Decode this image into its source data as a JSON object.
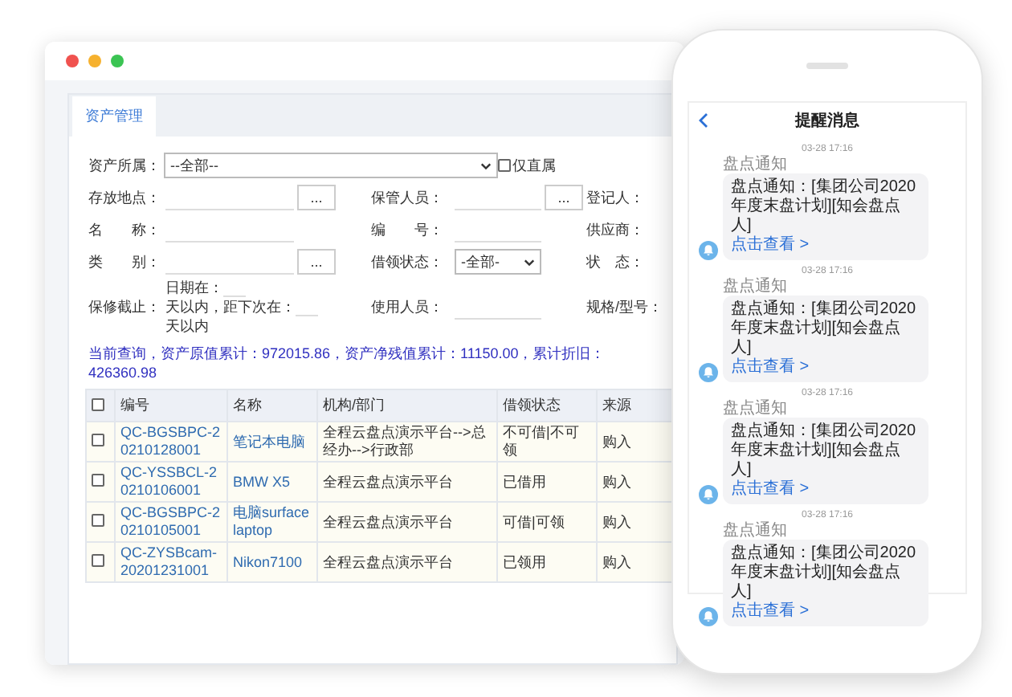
{
  "browser": {
    "tab": {
      "label": "资产管理",
      "selected": true
    },
    "form": {
      "rows": [
        {
          "kind": "owner",
          "label": "资产所属：",
          "select": "--全部--",
          "checkbox": {
            "label": "仅直属",
            "checked": false
          }
        },
        {
          "kind": "fields",
          "cells": [
            {
              "label": "存放地点：",
              "kind": "input",
              "button": "..."
            },
            {
              "label": "保管人员：",
              "kind": "input",
              "button": "..."
            },
            {
              "label": "登记人："
            }
          ]
        },
        {
          "kind": "fields",
          "cells": [
            {
              "label": "名　　称：",
              "kind": "input"
            },
            {
              "label": "编　　号：",
              "kind": "input"
            },
            {
              "label": "供应商："
            }
          ]
        },
        {
          "kind": "fields",
          "cells": [
            {
              "label": "类　　别：",
              "kind": "input",
              "button": "..."
            },
            {
              "label": "借领状态：",
              "kind": "select",
              "value": "-全部-"
            },
            {
              "label": "状　态："
            }
          ]
        },
        {
          "kind": "warranty",
          "label": "保修截止：",
          "parts": [
            "日期在：",
            "天以内，距下次在：",
            "天以内"
          ],
          "cells": [
            {
              "label": "使用人员：",
              "kind": "input"
            },
            {
              "label": "规格/型号："
            }
          ]
        }
      ]
    },
    "summary": "当前查询，资产原值累计：972015.86，资产净残值累计：11150.00，累计折旧：426360.98",
    "table": {
      "header_checked": false,
      "columns": [
        "编号",
        "名称",
        "机构/部门",
        "借领状态",
        "来源"
      ],
      "rows": [
        {
          "checked": false,
          "cells": [
            "QC-BGSBPC-20210128001",
            "笔记本电脑",
            "全程云盘点演示平台-->总经办-->行政部",
            "不可借|不可领",
            "购入"
          ]
        },
        {
          "checked": false,
          "cells": [
            "QC-YSSBCL-20210106001",
            "BMW X5",
            "全程云盘点演示平台",
            "已借用",
            "购入"
          ]
        },
        {
          "checked": false,
          "cells": [
            "QC-BGSBPC-20210105001",
            "电脑surface laptop",
            "全程云盘点演示平台",
            "可借|可领",
            "购入"
          ]
        },
        {
          "checked": false,
          "cells": [
            "QC-ZYSBcam-20201231001",
            "Nikon7100",
            "全程云盘点演示平台",
            "已领用",
            "购入"
          ]
        }
      ]
    }
  },
  "phone": {
    "title": "提醒消息",
    "messages": [
      {
        "time": "03-28 17:16",
        "sender": "盘点通知",
        "body": "盘点通知：[集团公司2020年度末盘计划][知会盘点人]",
        "link": "点击查看 >"
      },
      {
        "time": "03-28 17:16",
        "sender": "盘点通知",
        "body": "盘点通知：[集团公司2020年度末盘计划][知会盘点人]",
        "link": "点击查看 >"
      },
      {
        "time": "03-28 17:16",
        "sender": "盘点通知",
        "body": "盘点通知：[集团公司2020年度末盘计划][知会盘点人]",
        "link": "点击查看 >"
      },
      {
        "time": "03-28 17:16",
        "sender": "盘点通知",
        "body": "盘点通知：[集团公司2020年度末盘计划][知会盘点人]",
        "link": "点击查看 >"
      }
    ]
  }
}
